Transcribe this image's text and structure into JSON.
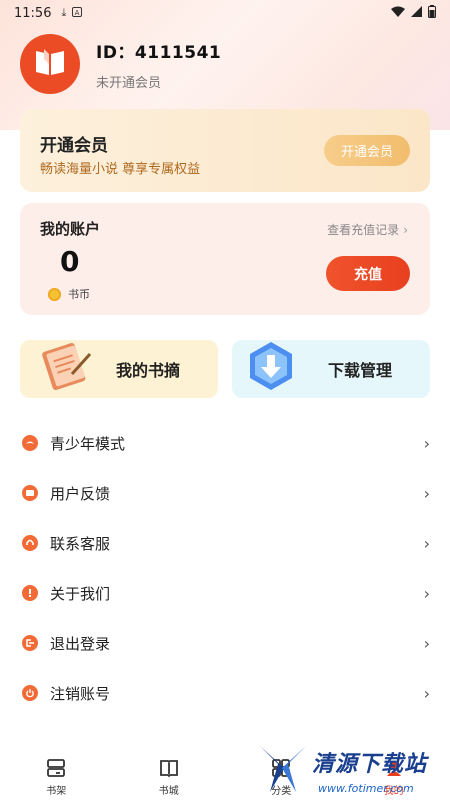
{
  "status_bar": {
    "time": "11:56"
  },
  "profile": {
    "id": "ID：4111541",
    "member_status": "未开通会员"
  },
  "vip": {
    "title": "开通会员",
    "subtitle": "畅读海量小说 尊享专属权益",
    "button": "开通会员"
  },
  "account": {
    "title": "我的账户",
    "balance": "0",
    "currency": "书币",
    "record_link": "查看充值记录",
    "recharge_button": "充值"
  },
  "tiles": {
    "notes": "我的书摘",
    "download": "下载管理"
  },
  "menu": [
    {
      "label": "青少年模式",
      "icon": "leaf-icon"
    },
    {
      "label": "用户反馈",
      "icon": "feedback-icon"
    },
    {
      "label": "联系客服",
      "icon": "headset-icon"
    },
    {
      "label": "关于我们",
      "icon": "info-icon"
    },
    {
      "label": "退出登录",
      "icon": "logout-icon"
    },
    {
      "label": "注销账号",
      "icon": "power-icon"
    }
  ],
  "bottom_nav": [
    {
      "label": "书架",
      "icon": "bookshelf-icon"
    },
    {
      "label": "书城",
      "icon": "book-icon"
    },
    {
      "label": "分类",
      "icon": "category-icon"
    },
    {
      "label": "我的",
      "icon": "user-icon"
    }
  ],
  "watermark": {
    "title": "清源下载站",
    "url": "www.fotimer.com"
  },
  "colors": {
    "accent": "#e8401f",
    "avatar": "#ec4c25",
    "vip_gold": "#f2bd6d"
  }
}
